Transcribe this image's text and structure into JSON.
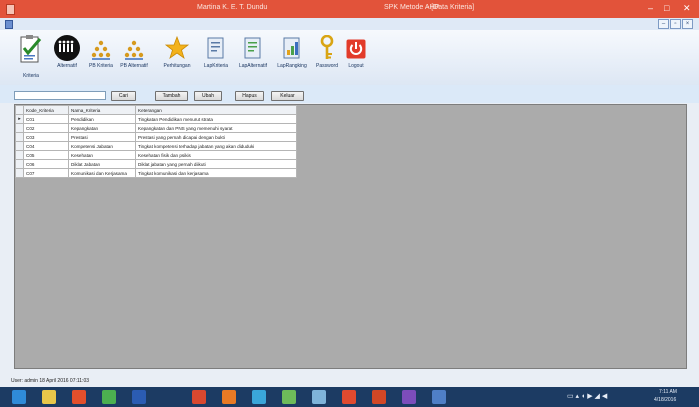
{
  "window": {
    "title_left": "Martina K. E. T. Dundu",
    "title_mid": "SPK Metode AHP",
    "title_right": "- [Data Kriteria]",
    "minimize": "–",
    "maximize": "□",
    "close": "✕",
    "mdi_controls": [
      "–",
      "▫",
      "×"
    ]
  },
  "toolbar": {
    "items": [
      {
        "label": "Kriteria",
        "icon": "criteria-clipboard-icon"
      },
      {
        "label": "Alternatif",
        "icon": "people-circle-icon"
      },
      {
        "label": "PB Kriteria",
        "icon": "people-pyramid-icon"
      },
      {
        "label": "PB Alternatif",
        "icon": "people-pyramid-icon"
      },
      {
        "label": "Perhitungan",
        "icon": "star-icon"
      },
      {
        "label": "LapKriteria",
        "icon": "report-icon"
      },
      {
        "label": "LapAlternatif",
        "icon": "report-icon"
      },
      {
        "label": "LapRangking",
        "icon": "report-icon"
      },
      {
        "label": "Password",
        "icon": "key-icon"
      },
      {
        "label": "Logout",
        "icon": "power-icon"
      }
    ]
  },
  "search": {
    "value": "",
    "buttons": {
      "cari": "Cari",
      "tambah": "Tambah",
      "ubah": "Ubah",
      "hapus": "Hapus",
      "keluar": "Keluar"
    }
  },
  "grid": {
    "columns": [
      "Kode_Kriteria",
      "Nama_Kriteria",
      "Keterangan"
    ],
    "current_row_marker": "▸",
    "rows": [
      [
        "C01",
        "Pendidikan",
        "Tingkatan Pendidikan menurut strata"
      ],
      [
        "C02",
        "Kepangkatan",
        "Kepangkatan dan PNS yang memenuhi syarat"
      ],
      [
        "C03",
        "Prestasi",
        "Prestasi yang pernah dicapai dengan bukti"
      ],
      [
        "C04",
        "Kompetensi Jabatan",
        "Tingkat kompetensi terhadap jabatan yang akan diduduki"
      ],
      [
        "C05",
        "Kesehatan",
        "Kesehatan fisik dan psikis"
      ],
      [
        "C06",
        "Diklat Jabatan",
        "Diklat jabatan yang pernah diikuti"
      ],
      [
        "C07",
        "Komunikasi dan Kerjasama",
        "Tingkat komunikasi dan kerjasama"
      ]
    ]
  },
  "status": {
    "text": "User: admin 18 April 2016 07:11:03"
  },
  "taskbar": {
    "apps": [
      {
        "name": "start-icon",
        "color": "#2f8bd8"
      },
      {
        "name": "explorer-icon",
        "color": "#e8c64a"
      },
      {
        "name": "media-icon",
        "color": "#e24f2c"
      },
      {
        "name": "chrome-icon",
        "color": "#4caf50"
      },
      {
        "name": "word-icon",
        "color": "#2b5cb3"
      },
      {
        "name": "cursor-icon",
        "color": "#1c3b63"
      },
      {
        "name": "office-icon",
        "color": "#d9482f"
      },
      {
        "name": "firefox-icon",
        "color": "#e87a25"
      },
      {
        "name": "paint-icon",
        "color": "#3aa6d9"
      },
      {
        "name": "photos-icon",
        "color": "#6dbb5a"
      },
      {
        "name": "table-icon",
        "color": "#7fb3d9"
      },
      {
        "name": "mail-icon",
        "color": "#e04a2f"
      },
      {
        "name": "powerpoint-icon",
        "color": "#d24726"
      },
      {
        "name": "visualstudio-icon",
        "color": "#7c4dbb"
      },
      {
        "name": "mdi-app-icon",
        "color": "#4f7fc6"
      }
    ],
    "time": "7:11 AM",
    "date": "4/18/2016"
  },
  "colors": {
    "titlebar": "#e2533a",
    "workspace": "#ababab",
    "taskbar": "#1c3b63"
  }
}
